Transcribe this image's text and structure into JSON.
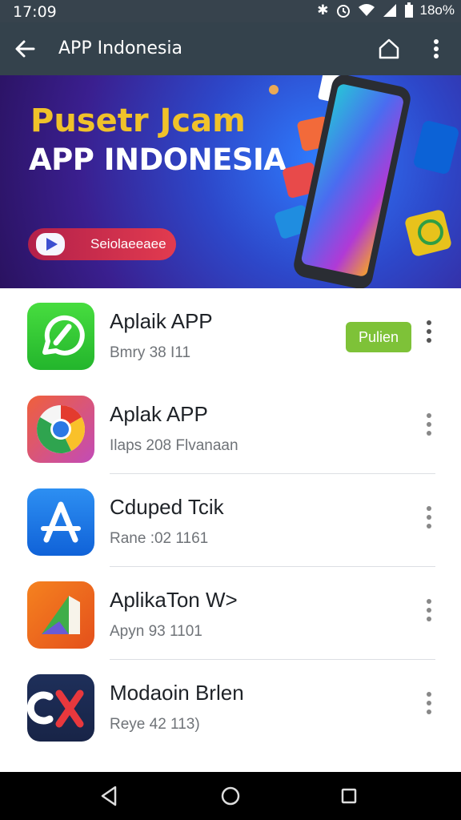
{
  "status": {
    "time": "17:09",
    "battery": "18o%"
  },
  "appbar": {
    "title": "APP Indonesia"
  },
  "banner": {
    "headline": "Pusetr Jcam",
    "subheadline": "APP INDONESIA",
    "button_label": "Seiolaeeaee"
  },
  "apps": [
    {
      "name": "Aplaik APP",
      "meta": "Bmry 38 I11",
      "action": "Pulien",
      "icon": "whatsapp-style-icon"
    },
    {
      "name": "Aplak APP",
      "meta": "Ilaps 208 Flvanaan",
      "icon": "chrome-style-icon"
    },
    {
      "name": "Cduped Tcik",
      "meta": "Rane :02 1161",
      "icon": "app-store-style-icon"
    },
    {
      "name": "AplikaTon W>",
      "meta": "Apyn 93 1101",
      "icon": "colorful-a-icon"
    },
    {
      "name": "Modaoin Brlen",
      "meta": "Reye 42 113)",
      "icon": "ck-logo-icon"
    }
  ],
  "colors": {
    "appbar": "#34424c",
    "statusbar": "#37434d",
    "accent_green": "#7ec238",
    "headline_yellow": "#f0c22a"
  }
}
